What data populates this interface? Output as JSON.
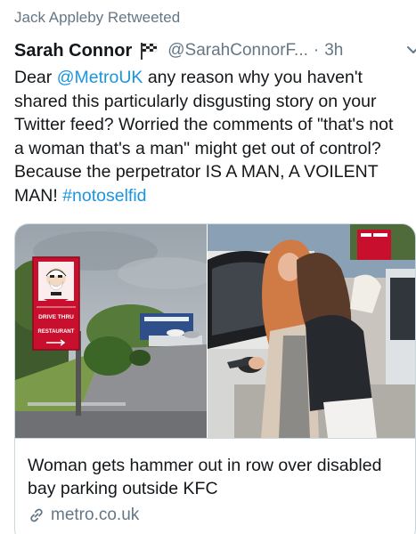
{
  "retweet_label": "Jack Appleby Retweeted",
  "author": {
    "display_name": "Sarah Connor",
    "handle": "@SarahConnorF...",
    "separator": "·",
    "time": "3h"
  },
  "tweet": {
    "line_prefix": "Dear ",
    "mention": "@MetroUK",
    "body": " any reason why you haven't shared this particularly disgusting story on your Twitter feed?  Worried the comments of \"that's not a woman that's a man\" might get out of control?  Because the perpetrator IS A MAN, A VOILENT MAN! ",
    "hashtag": "#notoselfid"
  },
  "card": {
    "sign_line1": "DRIVE THRU",
    "sign_line2": "RESTAURANT",
    "title": "Woman gets hammer out in row over disabled bay parking outside KFC",
    "domain": "metro.co.uk"
  },
  "colors": {
    "link": "#1b95e0",
    "secondary_text": "#657786",
    "kfc_red": "#c8102e"
  },
  "icons": {
    "flag": "checkered-flag-icon",
    "menu": "chevron-down-icon",
    "link": "link-icon"
  }
}
